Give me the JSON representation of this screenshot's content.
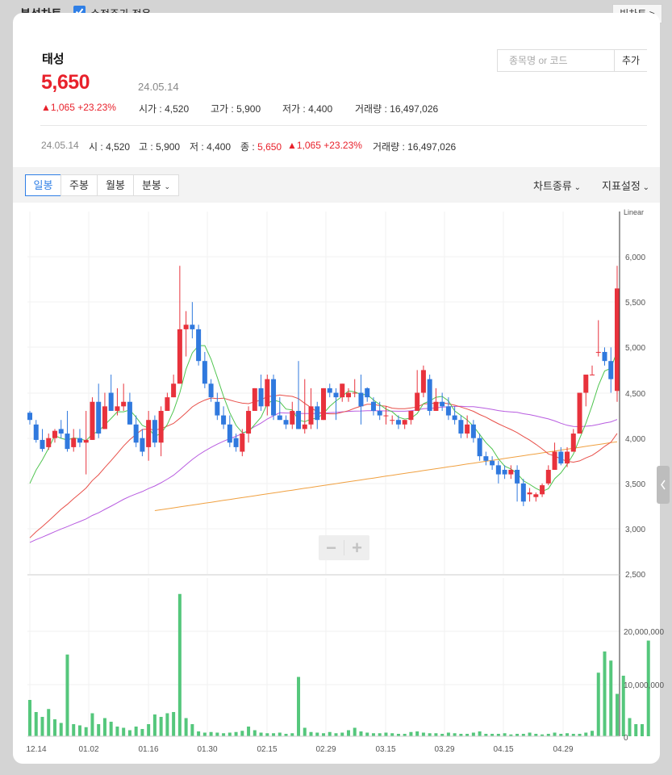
{
  "topbar": {
    "title": "분석차트",
    "adjusted_label": "수정주가 적용",
    "adjusted_checked": true,
    "big_chart_label": "빅차트 >"
  },
  "stock": {
    "name": "태성",
    "price": "5,650",
    "date": "24.05.14",
    "change": "▲1,065 +23.23%",
    "open_label": "시가",
    "open": "4,520",
    "high_label": "고가",
    "high": "5,900",
    "low_label": "저가",
    "low": "4,400",
    "volume_label": "거래량",
    "volume": "16,497,026"
  },
  "search": {
    "placeholder": "종목명 or 코드",
    "add_label": "추가"
  },
  "ohlc_row": {
    "date": "24.05.14",
    "o_label": "시",
    "o": "4,520",
    "h_label": "고",
    "h": "5,900",
    "l_label": "저",
    "l": "4,400",
    "c_label": "종",
    "c": "5,650",
    "change": "▲1,065 +23.23%",
    "vol_label": "거래량",
    "vol": "16,497,026"
  },
  "toolbar": {
    "tabs": [
      "일봉",
      "주봉",
      "월봉",
      "분봉"
    ],
    "active_tab": "일봉",
    "chart_type_label": "차트종류",
    "indicator_label": "지표설정"
  },
  "colors": {
    "up": "#e8323c",
    "down": "#3079de",
    "ma5": "#4ec44e",
    "ma20": "#e8504a",
    "ma60": "#b85ce0",
    "ma120": "#f0a040",
    "volume": "#55c77c",
    "accent": "#2f7fe6"
  },
  "chart_data": {
    "type": "candlestick",
    "scale_label": "Linear",
    "price_ticks": [
      "6,000",
      "5,500",
      "5,000",
      "4,500",
      "4,000",
      "3,500",
      "3,000",
      "2,500"
    ],
    "volume_ticks": [
      "20,000,000",
      "10,000,000",
      "0"
    ],
    "x_ticks": [
      "12.14",
      "01.02",
      "01.16",
      "01.30",
      "02.15",
      "02.29",
      "03.15",
      "03.29",
      "04.15",
      "04.29"
    ],
    "ylim": [
      2500,
      6200
    ],
    "volume_ylim": [
      0,
      24000000
    ],
    "candles": [
      [
        4280,
        4300,
        4150,
        4200
      ],
      [
        4150,
        4200,
        3950,
        3980
      ],
      [
        3980,
        4100,
        3850,
        3880
      ],
      [
        3900,
        4050,
        3870,
        4000
      ],
      [
        4000,
        4100,
        3950,
        4080
      ],
      [
        4100,
        4200,
        4000,
        4050
      ],
      [
        4050,
        4300,
        3850,
        3880
      ],
      [
        3900,
        4100,
        3850,
        4000
      ],
      [
        4000,
        4100,
        3900,
        3950
      ],
      [
        3950,
        4300,
        3600,
        3980
      ],
      [
        3980,
        4450,
        3980,
        4400
      ],
      [
        4400,
        4600,
        4000,
        4050
      ],
      [
        4100,
        4500,
        4100,
        4350
      ],
      [
        4500,
        4700,
        4300,
        4300
      ],
      [
        4300,
        4550,
        4250,
        4350
      ],
      [
        4350,
        4600,
        4300,
        4400
      ],
      [
        4400,
        4500,
        4150,
        4150
      ],
      [
        4150,
        4250,
        3900,
        3950
      ],
      [
        4000,
        4100,
        3800,
        3850
      ],
      [
        3900,
        4300,
        3750,
        4200
      ],
      [
        4200,
        4250,
        3900,
        3950
      ],
      [
        3950,
        4350,
        3800,
        4300
      ],
      [
        4300,
        4500,
        4300,
        4450
      ],
      [
        4450,
        4700,
        4450,
        4600
      ],
      [
        4600,
        5900,
        4600,
        5200
      ],
      [
        5200,
        5400,
        4900,
        5250
      ],
      [
        5250,
        5500,
        5100,
        5200
      ],
      [
        5200,
        5250,
        4800,
        4850
      ],
      [
        4850,
        4950,
        4550,
        4600
      ],
      [
        4600,
        4650,
        4400,
        4450
      ],
      [
        4400,
        4500,
        4200,
        4250
      ],
      [
        4250,
        4350,
        4100,
        4150
      ],
      [
        4150,
        4250,
        3900,
        3950
      ],
      [
        4000,
        4050,
        3850,
        3900
      ],
      [
        3850,
        4100,
        3800,
        4050
      ],
      [
        4050,
        4350,
        3950,
        4300
      ],
      [
        4300,
        4550,
        4300,
        4550
      ],
      [
        4550,
        4700,
        4300,
        4350
      ],
      [
        4350,
        4700,
        4250,
        4650
      ],
      [
        4650,
        4700,
        4200,
        4250
      ],
      [
        4250,
        4450,
        4200,
        4200
      ],
      [
        4200,
        4250,
        4100,
        4150
      ],
      [
        4150,
        4400,
        4100,
        4300
      ],
      [
        4300,
        4850,
        4100,
        4100
      ],
      [
        4100,
        4650,
        4050,
        4150
      ],
      [
        4150,
        4550,
        4100,
        4350
      ],
      [
        4350,
        4400,
        4100,
        4200
      ],
      [
        4200,
        4550,
        4200,
        4550
      ],
      [
        4550,
        4600,
        4450,
        4500
      ],
      [
        4500,
        4550,
        4200,
        4450
      ],
      [
        4450,
        4600,
        4400,
        4600
      ],
      [
        4450,
        4550,
        4400,
        4500
      ],
      [
        4500,
        4650,
        4450,
        4500
      ],
      [
        4500,
        4700,
        4150,
        4350
      ],
      [
        4550,
        4560,
        4400,
        4450
      ],
      [
        4400,
        4450,
        4250,
        4300
      ],
      [
        4300,
        4400,
        4200,
        4250
      ],
      [
        4250,
        4350,
        4150,
        4250
      ],
      [
        4200,
        4250,
        4150,
        4200
      ],
      [
        4200,
        4250,
        4100,
        4150
      ],
      [
        4150,
        4200,
        4100,
        4200
      ],
      [
        4200,
        4300,
        4150,
        4300
      ],
      [
        4300,
        4750,
        4300,
        4500
      ],
      [
        4500,
        4800,
        4450,
        4750
      ],
      [
        4650,
        4700,
        4250,
        4300
      ],
      [
        4300,
        4550,
        4300,
        4400
      ],
      [
        4400,
        4500,
        4300,
        4350
      ],
      [
        4350,
        4450,
        4200,
        4250
      ],
      [
        4250,
        4350,
        4150,
        4200
      ],
      [
        4200,
        4250,
        4000,
        4050
      ],
      [
        4050,
        4250,
        4000,
        4150
      ],
      [
        4150,
        4200,
        3950,
        4000
      ],
      [
        4000,
        4050,
        3750,
        3800
      ],
      [
        3800,
        3850,
        3700,
        3750
      ],
      [
        3750,
        3800,
        3650,
        3700
      ],
      [
        3700,
        3750,
        3500,
        3600
      ],
      [
        3650,
        3700,
        3550,
        3600
      ],
      [
        3600,
        3700,
        3550,
        3650
      ],
      [
        3650,
        3700,
        3300,
        3500
      ],
      [
        3500,
        3550,
        3250,
        3300
      ],
      [
        3380,
        3450,
        3300,
        3400
      ],
      [
        3350,
        3400,
        3300,
        3380
      ],
      [
        3380,
        3500,
        3350,
        3480
      ],
      [
        3500,
        3700,
        3480,
        3650
      ],
      [
        3650,
        3950,
        3650,
        3850
      ],
      [
        3850,
        3900,
        3700,
        3720
      ],
      [
        3720,
        3900,
        3680,
        3850
      ],
      [
        3850,
        4100,
        3850,
        4050
      ],
      [
        4050,
        4450,
        4050,
        4500
      ],
      [
        4500,
        4650,
        4350,
        4700
      ],
      [
        4700,
        4800,
        4700,
        4700
      ],
      [
        4950,
        5300,
        4900,
        4950
      ],
      [
        4950,
        5000,
        4800,
        4850
      ],
      [
        4850,
        5000,
        4500,
        4650
      ],
      [
        4520,
        5900,
        4400,
        5650
      ]
    ],
    "volumes": [
      6.0,
      4.0,
      3.2,
      4.5,
      2.8,
      2.2,
      13.5,
      2.0,
      1.8,
      1.5,
      3.8,
      2.0,
      3.0,
      2.4,
      1.6,
      1.4,
      1.0,
      1.6,
      1.2,
      2.0,
      3.6,
      3.2,
      3.8,
      4.0,
      23.5,
      3.0,
      2.0,
      0.8,
      0.6,
      0.7,
      0.6,
      0.5,
      0.6,
      0.7,
      0.9,
      1.6,
      1.0,
      0.6,
      0.5,
      0.5,
      0.6,
      0.4,
      0.5,
      9.8,
      1.4,
      0.7,
      0.6,
      0.5,
      0.7,
      0.5,
      0.6,
      1.0,
      1.4,
      0.8,
      0.6,
      0.5,
      0.5,
      0.6,
      0.5,
      0.4,
      0.4,
      0.7,
      0.8,
      0.6,
      0.5,
      0.5,
      0.4,
      0.6,
      0.5,
      0.4,
      0.4,
      0.6,
      0.8,
      0.4,
      0.4,
      0.4,
      0.5,
      0.3,
      0.4,
      0.4,
      0.6,
      0.4,
      0.3,
      0.4,
      0.6,
      0.4,
      0.5,
      0.4,
      0.4,
      0.6,
      0.9,
      10.5,
      14.0,
      12.5,
      7.0,
      10.0,
      3.0,
      2.0,
      2.0,
      15.8
    ],
    "volume_scale": 1000000
  }
}
